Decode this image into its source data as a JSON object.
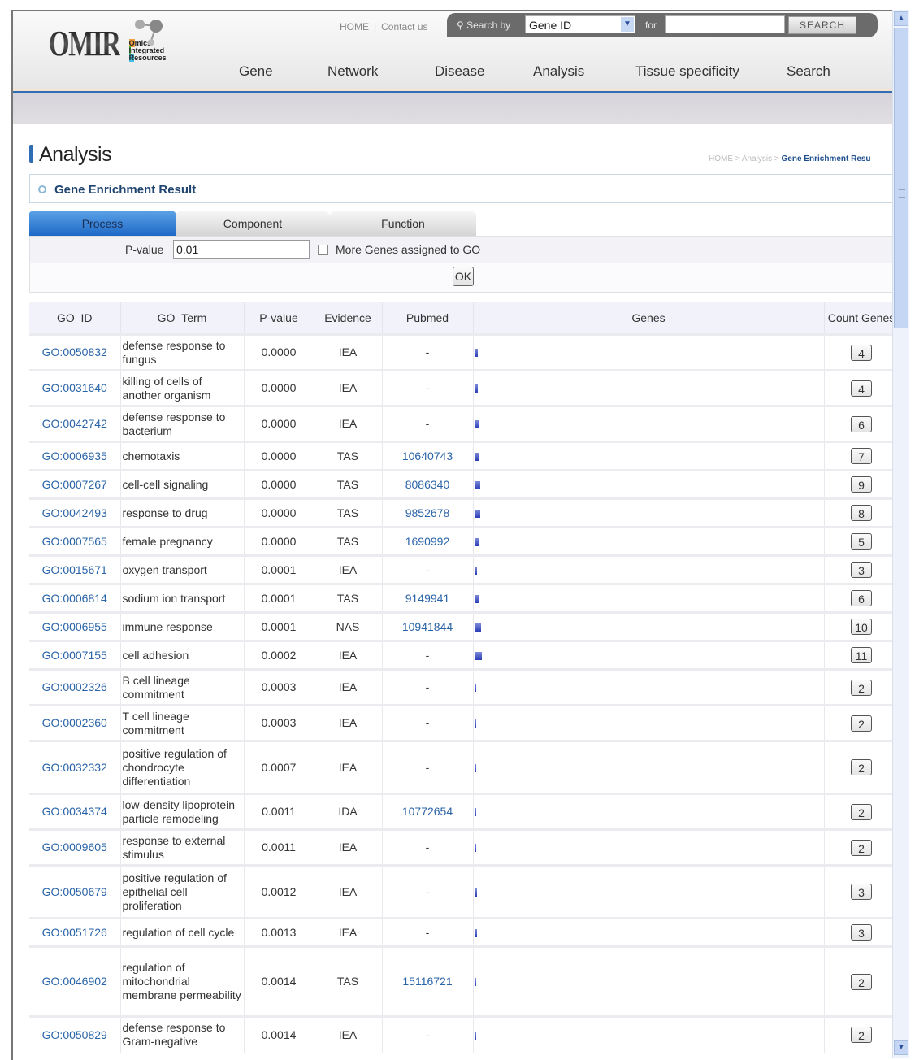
{
  "header": {
    "logo_text": "OMIR",
    "logo_sub": [
      "mics",
      "ntegrated",
      "esources"
    ],
    "logo_initials": [
      "O",
      "I",
      "R"
    ],
    "top_links": [
      "HOME",
      "Contact us"
    ],
    "search": {
      "search_by_label": "Search by",
      "search_by_value": "Gene ID",
      "for_label": "for",
      "query_value": "",
      "button_label": "SEARCH"
    },
    "nav": [
      "Gene",
      "Network",
      "Disease",
      "Analysis",
      "Tissue specificity",
      "Search"
    ]
  },
  "page": {
    "title": "Analysis",
    "breadcrumb": [
      "HOME",
      "Analysis",
      "Gene Enrichment Resu"
    ],
    "section_title": "Gene Enrichment Result",
    "tabs": [
      {
        "label": "Process",
        "active": true
      },
      {
        "label": "Component",
        "active": false
      },
      {
        "label": "Function",
        "active": false
      }
    ],
    "form": {
      "pvalue_label": "P-value",
      "pvalue_value": "0.01",
      "more_genes_label": "More Genes assigned to GO",
      "more_genes_checked": false,
      "ok_label": "OK"
    }
  },
  "table": {
    "columns": [
      "GO_ID",
      "GO_Term",
      "P-value",
      "Evidence",
      "Pubmed",
      "Genes",
      "Count Genes"
    ],
    "rows": [
      {
        "go_id": "GO:0050832",
        "term": "defense response to fungus",
        "pvalue": "0.0000",
        "evidence": "IEA",
        "pubmed": "-",
        "count": "4"
      },
      {
        "go_id": "GO:0031640",
        "term": "killing of cells of another organism",
        "pvalue": "0.0000",
        "evidence": "IEA",
        "pubmed": "-",
        "count": "4"
      },
      {
        "go_id": "GO:0042742",
        "term": "defense response to bacterium",
        "pvalue": "0.0000",
        "evidence": "IEA",
        "pubmed": "-",
        "count": "6"
      },
      {
        "go_id": "GO:0006935",
        "term": "chemotaxis",
        "pvalue": "0.0000",
        "evidence": "TAS",
        "pubmed": "10640743",
        "count": "7"
      },
      {
        "go_id": "GO:0007267",
        "term": "cell-cell signaling",
        "pvalue": "0.0000",
        "evidence": "TAS",
        "pubmed": "8086340",
        "count": "9"
      },
      {
        "go_id": "GO:0042493",
        "term": "response to drug",
        "pvalue": "0.0000",
        "evidence": "TAS",
        "pubmed": "9852678",
        "count": "8"
      },
      {
        "go_id": "GO:0007565",
        "term": "female pregnancy",
        "pvalue": "0.0000",
        "evidence": "TAS",
        "pubmed": "1690992",
        "count": "5"
      },
      {
        "go_id": "GO:0015671",
        "term": "oxygen transport",
        "pvalue": "0.0001",
        "evidence": "IEA",
        "pubmed": "-",
        "count": "3"
      },
      {
        "go_id": "GO:0006814",
        "term": "sodium ion transport",
        "pvalue": "0.0001",
        "evidence": "TAS",
        "pubmed": "9149941",
        "count": "6"
      },
      {
        "go_id": "GO:0006955",
        "term": "immune response",
        "pvalue": "0.0001",
        "evidence": "NAS",
        "pubmed": "10941844",
        "count": "10"
      },
      {
        "go_id": "GO:0007155",
        "term": "cell adhesion",
        "pvalue": "0.0002",
        "evidence": "IEA",
        "pubmed": "-",
        "count": "11"
      },
      {
        "go_id": "GO:0002326",
        "term": "B cell lineage commitment",
        "pvalue": "0.0003",
        "evidence": "IEA",
        "pubmed": "-",
        "count": "2"
      },
      {
        "go_id": "GO:0002360",
        "term": "T cell lineage commitment",
        "pvalue": "0.0003",
        "evidence": "IEA",
        "pubmed": "-",
        "count": "2"
      },
      {
        "go_id": "GO:0032332",
        "term": "positive regulation of chondrocyte differentiation",
        "pvalue": "0.0007",
        "evidence": "IEA",
        "pubmed": "-",
        "count": "2"
      },
      {
        "go_id": "GO:0034374",
        "term": "low-density lipoprotein particle remodeling",
        "pvalue": "0.0011",
        "evidence": "IDA",
        "pubmed": "10772654",
        "count": "2"
      },
      {
        "go_id": "GO:0009605",
        "term": "response to external stimulus",
        "pvalue": "0.0011",
        "evidence": "IEA",
        "pubmed": "-",
        "count": "2"
      },
      {
        "go_id": "GO:0050679",
        "term": "positive regulation of epithelial cell proliferation",
        "pvalue": "0.0012",
        "evidence": "IEA",
        "pubmed": "-",
        "count": "3"
      },
      {
        "go_id": "GO:0051726",
        "term": "regulation of cell cycle",
        "pvalue": "0.0013",
        "evidence": "IEA",
        "pubmed": "-",
        "count": "3"
      },
      {
        "go_id": "GO:0046902",
        "term": "regulation of mitochondrial membrane permeability",
        "pvalue": "0.0014",
        "evidence": "TAS",
        "pubmed": "15116721",
        "count": "2"
      },
      {
        "go_id": "GO:0050829",
        "term": "defense response to Gram-negative",
        "pvalue": "0.0014",
        "evidence": "IEA",
        "pubmed": "-",
        "count": "2"
      }
    ]
  },
  "colors": {
    "accent_blue": "#2e6db4",
    "link": "#2a64a8",
    "section_title": "#1f4470"
  }
}
